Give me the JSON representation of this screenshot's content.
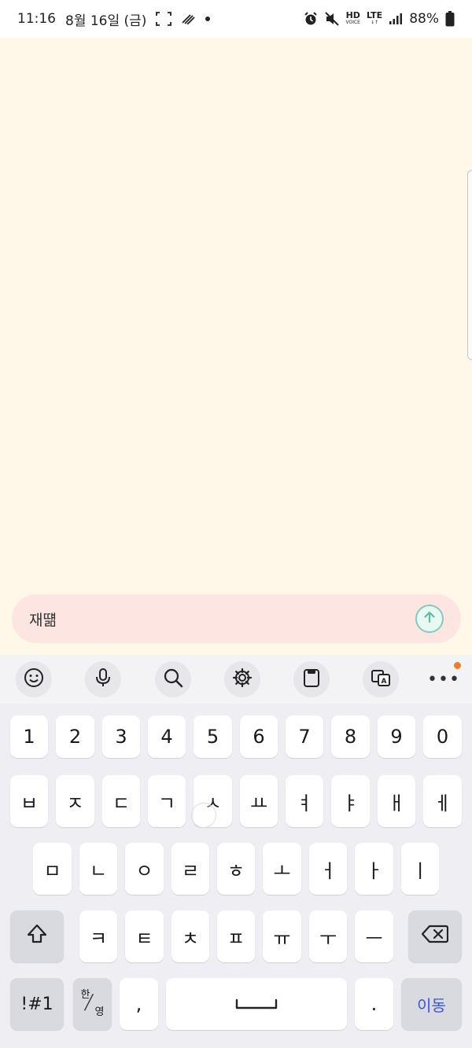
{
  "status_bar": {
    "time": "11:16",
    "date": "8월 16일 (금)",
    "battery": "88%",
    "hd_label": "HD",
    "hd_sub": "VOICE",
    "lte_label": "LTE",
    "icons": [
      "screenshot-icon",
      "signal-bars-icon",
      "dot-icon",
      "alarm-icon",
      "mute-icon",
      "hd-voice-icon",
      "lte-icon",
      "cell-signal-icon",
      "battery-icon"
    ]
  },
  "message_input": {
    "value": "재떎",
    "send_icon": "arrow-up-circle-icon",
    "colors": {
      "bar": "#fde6e2",
      "send_ring": "#7fcdbb"
    }
  },
  "keyboard_toolbar": {
    "items": [
      "emoji-icon",
      "microphone-icon",
      "search-icon",
      "gear-icon",
      "clipboard-icon",
      "translate-icon",
      "more-icon"
    ],
    "more_label": "•••"
  },
  "keyboard": {
    "numbers": [
      "1",
      "2",
      "3",
      "4",
      "5",
      "6",
      "7",
      "8",
      "9",
      "0"
    ],
    "row1": [
      "ㅂ",
      "ㅈ",
      "ㄷ",
      "ㄱ",
      "ㅅ",
      "ㅛ",
      "ㅕ",
      "ㅑ",
      "ㅐ",
      "ㅔ"
    ],
    "row2": [
      "ㅁ",
      "ㄴ",
      "ㅇ",
      "ㄹ",
      "ㅎ",
      "ㅗ",
      "ㅓ",
      "ㅏ",
      "ㅣ"
    ],
    "row3": [
      "ㅋ",
      "ㅌ",
      "ㅊ",
      "ㅍ",
      "ㅠ",
      "ㅜ",
      "ㅡ"
    ],
    "symbols_label": "!#1",
    "lang_top": "한",
    "lang_bottom": "영",
    "comma": ",",
    "period": ".",
    "go_label": "이동"
  }
}
